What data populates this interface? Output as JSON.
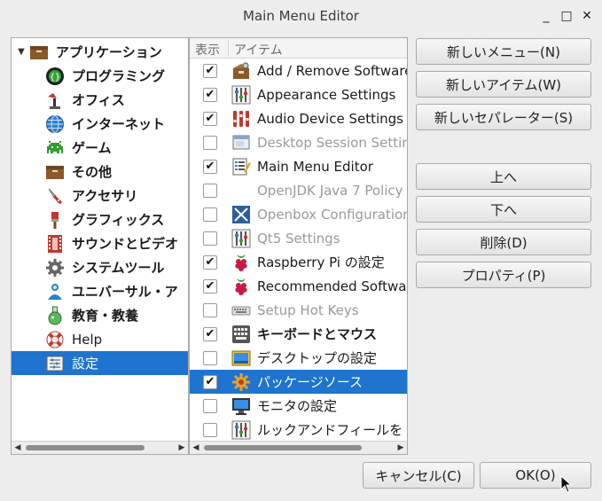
{
  "window": {
    "title": "Main Menu Editor",
    "min_glyph": "_",
    "max_glyph": "□",
    "close_glyph": "✕"
  },
  "tree": {
    "root": {
      "label": "アプリケーション",
      "expanded_glyph": "▼",
      "icon": "folder-icon"
    },
    "items": [
      {
        "label": "プログラミング",
        "icon": "programming-icon"
      },
      {
        "label": "オフィス",
        "icon": "office-icon"
      },
      {
        "label": "インターネット",
        "icon": "globe-icon"
      },
      {
        "label": "ゲーム",
        "icon": "game-icon"
      },
      {
        "label": "その他",
        "icon": "folder-icon"
      },
      {
        "label": "アクセサリ",
        "icon": "knife-icon"
      },
      {
        "label": "グラフィックス",
        "icon": "brush-icon"
      },
      {
        "label": "サウンドとビデオ",
        "icon": "film-icon"
      },
      {
        "label": "システムツール",
        "icon": "gear-icon"
      },
      {
        "label": "ユニバーサル・ア",
        "icon": "person-icon"
      },
      {
        "label": "教育・教養",
        "icon": "flask-icon"
      },
      {
        "label": "Help",
        "icon": "lifebuoy-icon"
      },
      {
        "label": "設定",
        "icon": "settings-icon",
        "selected": true
      }
    ]
  },
  "items_list": {
    "header_show": "表示",
    "header_item": "アイテム",
    "rows": [
      {
        "label": "Add / Remove Software",
        "checked": true,
        "dim": false,
        "icon": "package-icon"
      },
      {
        "label": "Appearance Settings",
        "checked": true,
        "dim": false,
        "icon": "sliders-icon"
      },
      {
        "label": "Audio Device Settings",
        "checked": true,
        "dim": false,
        "icon": "audio-sliders-icon"
      },
      {
        "label": "Desktop Session Settings",
        "checked": false,
        "dim": true,
        "icon": "window-icon"
      },
      {
        "label": "Main Menu Editor",
        "checked": true,
        "dim": false,
        "icon": "menu-editor-icon"
      },
      {
        "label": "OpenJDK Java 7 Policy",
        "checked": false,
        "dim": true,
        "icon": "none"
      },
      {
        "label": "Openbox Configuration",
        "checked": false,
        "dim": true,
        "icon": "openbox-icon"
      },
      {
        "label": "Qt5 Settings",
        "checked": false,
        "dim": true,
        "icon": "sliders-icon"
      },
      {
        "label": "Raspberry Pi の設定",
        "checked": true,
        "dim": false,
        "icon": "raspberry-icon"
      },
      {
        "label": "Recommended Software",
        "checked": true,
        "dim": false,
        "icon": "raspberry-icon"
      },
      {
        "label": "Setup Hot Keys",
        "checked": false,
        "dim": true,
        "icon": "keyboard-icon"
      },
      {
        "label": "キーボードとマウス",
        "checked": true,
        "dim": false,
        "icon": "keyboard-mouse-icon"
      },
      {
        "label": "デスクトップの設定",
        "checked": false,
        "dim": false,
        "icon": "desktop-icon"
      },
      {
        "label": "パッケージソース",
        "checked": true,
        "dim": false,
        "icon": "package-source-icon",
        "selected": true
      },
      {
        "label": "モニタの設定",
        "checked": false,
        "dim": false,
        "icon": "monitor-icon"
      },
      {
        "label": "ルックアンドフィールを",
        "checked": false,
        "dim": false,
        "icon": "sliders-icon"
      }
    ],
    "check_glyph": "✔"
  },
  "buttons": {
    "new_menu": "新しいメニュー(N)",
    "new_item": "新しいアイテム(W)",
    "new_separator": "新しいセパレーター(S)",
    "move_up": "上へ",
    "move_down": "下へ",
    "delete": "削除(D)",
    "properties": "プロパティ(P)",
    "cancel": "キャンセル(C)",
    "ok": "OK(O)"
  },
  "colors": {
    "selection": "#1e74cf",
    "window_bg": "#ededed"
  }
}
